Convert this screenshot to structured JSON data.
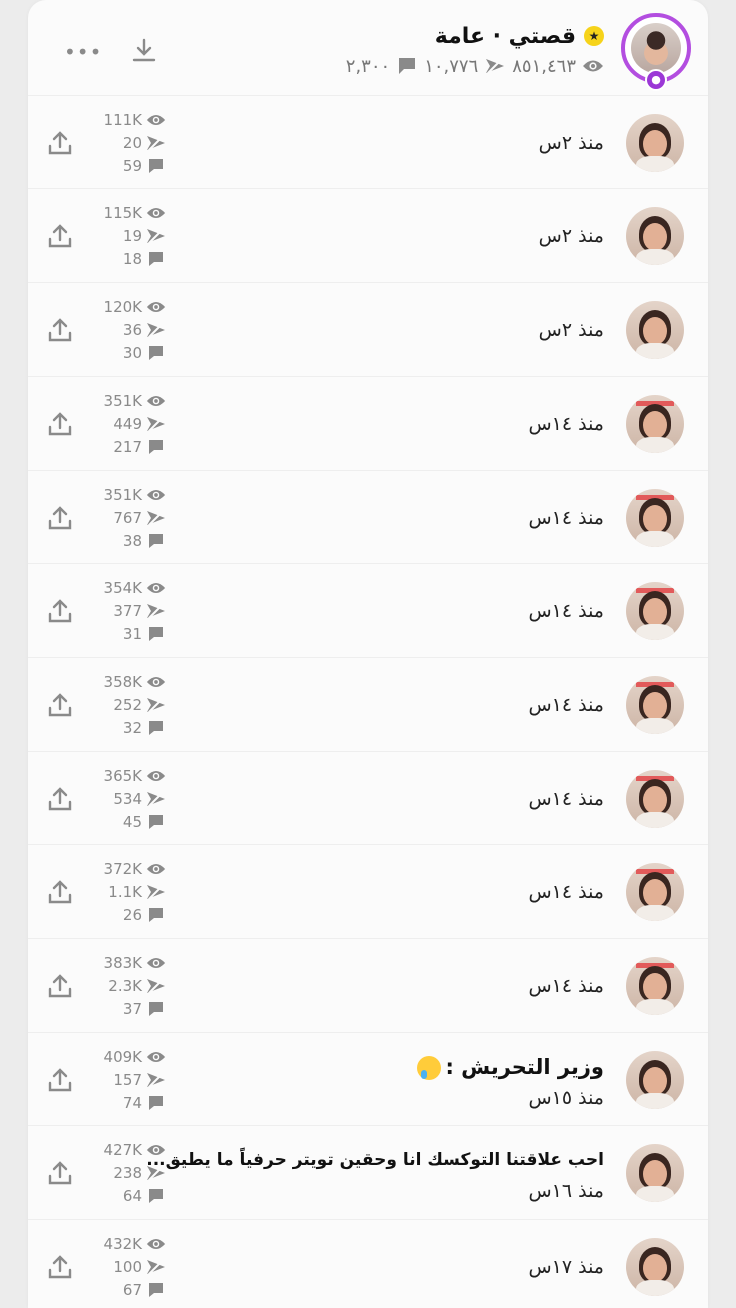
{
  "header": {
    "title": "قصتي · عامة",
    "views": "٨٥١,٤٦٣",
    "screenshots": "١٠,٧٧٦",
    "replies": "٢,٣٠٠"
  },
  "rows": [
    {
      "time": "منذ ٢س",
      "views": "111K",
      "screens": "20",
      "replies": "59",
      "caption": ""
    },
    {
      "time": "منذ ٢س",
      "views": "115K",
      "screens": "19",
      "replies": "18",
      "caption": ""
    },
    {
      "time": "منذ ٢س",
      "views": "120K",
      "screens": "36",
      "replies": "30",
      "caption": ""
    },
    {
      "time": "منذ ١٤س",
      "views": "351K",
      "screens": "449",
      "replies": "217",
      "caption": ""
    },
    {
      "time": "منذ ١٤س",
      "views": "351K",
      "screens": "767",
      "replies": "38",
      "caption": ""
    },
    {
      "time": "منذ ١٤س",
      "views": "354K",
      "screens": "377",
      "replies": "31",
      "caption": ""
    },
    {
      "time": "منذ ١٤س",
      "views": "358K",
      "screens": "252",
      "replies": "32",
      "caption": ""
    },
    {
      "time": "منذ ١٤س",
      "views": "365K",
      "screens": "534",
      "replies": "45",
      "caption": ""
    },
    {
      "time": "منذ ١٤س",
      "views": "372K",
      "screens": "1.1K",
      "replies": "26",
      "caption": ""
    },
    {
      "time": "منذ ١٤س",
      "views": "383K",
      "screens": "2.3K",
      "replies": "37",
      "caption": ""
    },
    {
      "time": "منذ ١٥س",
      "views": "409K",
      "screens": "157",
      "replies": "74",
      "caption": "وزير التحريش :"
    },
    {
      "time": "منذ ١٦س",
      "views": "427K",
      "screens": "238",
      "replies": "64",
      "caption": "احب علاقتنا التوكسك انا وحقين تويتر حرفياً ما يطيق..."
    },
    {
      "time": "منذ ١٧س",
      "views": "432K",
      "screens": "100",
      "replies": "67",
      "caption": ""
    }
  ],
  "colors": {
    "accent_ring": "#b34ee0",
    "badge_yellow": "#f6d31a",
    "icon_gray": "#8a8a8a"
  }
}
